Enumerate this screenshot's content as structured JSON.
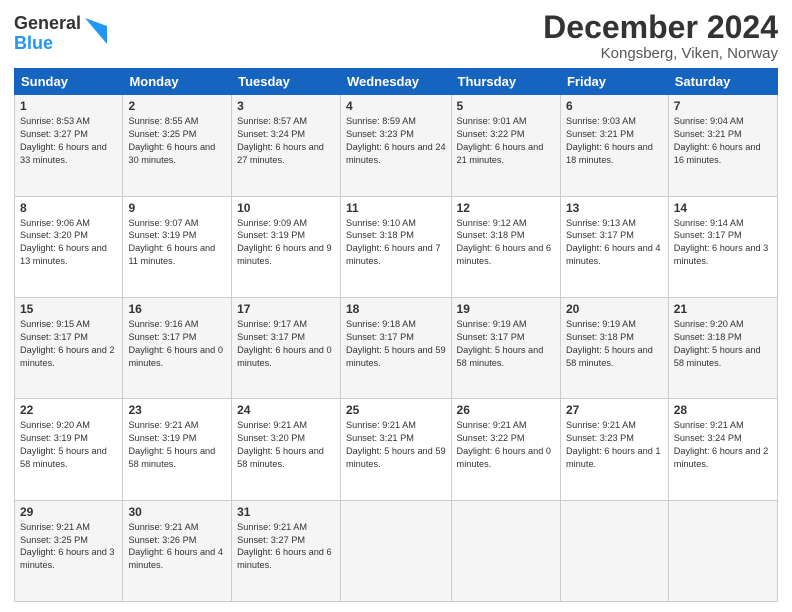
{
  "logo": {
    "general": "General",
    "blue": "Blue"
  },
  "title": "December 2024",
  "subtitle": "Kongsberg, Viken, Norway",
  "days": [
    "Sunday",
    "Monday",
    "Tuesday",
    "Wednesday",
    "Thursday",
    "Friday",
    "Saturday"
  ],
  "weeks": [
    [
      {
        "day": "1",
        "sunrise": "Sunrise: 8:53 AM",
        "sunset": "Sunset: 3:27 PM",
        "daylight": "Daylight: 6 hours and 33 minutes."
      },
      {
        "day": "2",
        "sunrise": "Sunrise: 8:55 AM",
        "sunset": "Sunset: 3:25 PM",
        "daylight": "Daylight: 6 hours and 30 minutes."
      },
      {
        "day": "3",
        "sunrise": "Sunrise: 8:57 AM",
        "sunset": "Sunset: 3:24 PM",
        "daylight": "Daylight: 6 hours and 27 minutes."
      },
      {
        "day": "4",
        "sunrise": "Sunrise: 8:59 AM",
        "sunset": "Sunset: 3:23 PM",
        "daylight": "Daylight: 6 hours and 24 minutes."
      },
      {
        "day": "5",
        "sunrise": "Sunrise: 9:01 AM",
        "sunset": "Sunset: 3:22 PM",
        "daylight": "Daylight: 6 hours and 21 minutes."
      },
      {
        "day": "6",
        "sunrise": "Sunrise: 9:03 AM",
        "sunset": "Sunset: 3:21 PM",
        "daylight": "Daylight: 6 hours and 18 minutes."
      },
      {
        "day": "7",
        "sunrise": "Sunrise: 9:04 AM",
        "sunset": "Sunset: 3:21 PM",
        "daylight": "Daylight: 6 hours and 16 minutes."
      }
    ],
    [
      {
        "day": "8",
        "sunrise": "Sunrise: 9:06 AM",
        "sunset": "Sunset: 3:20 PM",
        "daylight": "Daylight: 6 hours and 13 minutes."
      },
      {
        "day": "9",
        "sunrise": "Sunrise: 9:07 AM",
        "sunset": "Sunset: 3:19 PM",
        "daylight": "Daylight: 6 hours and 11 minutes."
      },
      {
        "day": "10",
        "sunrise": "Sunrise: 9:09 AM",
        "sunset": "Sunset: 3:19 PM",
        "daylight": "Daylight: 6 hours and 9 minutes."
      },
      {
        "day": "11",
        "sunrise": "Sunrise: 9:10 AM",
        "sunset": "Sunset: 3:18 PM",
        "daylight": "Daylight: 6 hours and 7 minutes."
      },
      {
        "day": "12",
        "sunrise": "Sunrise: 9:12 AM",
        "sunset": "Sunset: 3:18 PM",
        "daylight": "Daylight: 6 hours and 6 minutes."
      },
      {
        "day": "13",
        "sunrise": "Sunrise: 9:13 AM",
        "sunset": "Sunset: 3:17 PM",
        "daylight": "Daylight: 6 hours and 4 minutes."
      },
      {
        "day": "14",
        "sunrise": "Sunrise: 9:14 AM",
        "sunset": "Sunset: 3:17 PM",
        "daylight": "Daylight: 6 hours and 3 minutes."
      }
    ],
    [
      {
        "day": "15",
        "sunrise": "Sunrise: 9:15 AM",
        "sunset": "Sunset: 3:17 PM",
        "daylight": "Daylight: 6 hours and 2 minutes."
      },
      {
        "day": "16",
        "sunrise": "Sunrise: 9:16 AM",
        "sunset": "Sunset: 3:17 PM",
        "daylight": "Daylight: 6 hours and 0 minutes."
      },
      {
        "day": "17",
        "sunrise": "Sunrise: 9:17 AM",
        "sunset": "Sunset: 3:17 PM",
        "daylight": "Daylight: 6 hours and 0 minutes."
      },
      {
        "day": "18",
        "sunrise": "Sunrise: 9:18 AM",
        "sunset": "Sunset: 3:17 PM",
        "daylight": "Daylight: 5 hours and 59 minutes."
      },
      {
        "day": "19",
        "sunrise": "Sunrise: 9:19 AM",
        "sunset": "Sunset: 3:17 PM",
        "daylight": "Daylight: 5 hours and 58 minutes."
      },
      {
        "day": "20",
        "sunrise": "Sunrise: 9:19 AM",
        "sunset": "Sunset: 3:18 PM",
        "daylight": "Daylight: 5 hours and 58 minutes."
      },
      {
        "day": "21",
        "sunrise": "Sunrise: 9:20 AM",
        "sunset": "Sunset: 3:18 PM",
        "daylight": "Daylight: 5 hours and 58 minutes."
      }
    ],
    [
      {
        "day": "22",
        "sunrise": "Sunrise: 9:20 AM",
        "sunset": "Sunset: 3:19 PM",
        "daylight": "Daylight: 5 hours and 58 minutes."
      },
      {
        "day": "23",
        "sunrise": "Sunrise: 9:21 AM",
        "sunset": "Sunset: 3:19 PM",
        "daylight": "Daylight: 5 hours and 58 minutes."
      },
      {
        "day": "24",
        "sunrise": "Sunrise: 9:21 AM",
        "sunset": "Sunset: 3:20 PM",
        "daylight": "Daylight: 5 hours and 58 minutes."
      },
      {
        "day": "25",
        "sunrise": "Sunrise: 9:21 AM",
        "sunset": "Sunset: 3:21 PM",
        "daylight": "Daylight: 5 hours and 59 minutes."
      },
      {
        "day": "26",
        "sunrise": "Sunrise: 9:21 AM",
        "sunset": "Sunset: 3:22 PM",
        "daylight": "Daylight: 6 hours and 0 minutes."
      },
      {
        "day": "27",
        "sunrise": "Sunrise: 9:21 AM",
        "sunset": "Sunset: 3:23 PM",
        "daylight": "Daylight: 6 hours and 1 minute."
      },
      {
        "day": "28",
        "sunrise": "Sunrise: 9:21 AM",
        "sunset": "Sunset: 3:24 PM",
        "daylight": "Daylight: 6 hours and 2 minutes."
      }
    ],
    [
      {
        "day": "29",
        "sunrise": "Sunrise: 9:21 AM",
        "sunset": "Sunset: 3:25 PM",
        "daylight": "Daylight: 6 hours and 3 minutes."
      },
      {
        "day": "30",
        "sunrise": "Sunrise: 9:21 AM",
        "sunset": "Sunset: 3:26 PM",
        "daylight": "Daylight: 6 hours and 4 minutes."
      },
      {
        "day": "31",
        "sunrise": "Sunrise: 9:21 AM",
        "sunset": "Sunset: 3:27 PM",
        "daylight": "Daylight: 6 hours and 6 minutes."
      },
      null,
      null,
      null,
      null
    ]
  ]
}
